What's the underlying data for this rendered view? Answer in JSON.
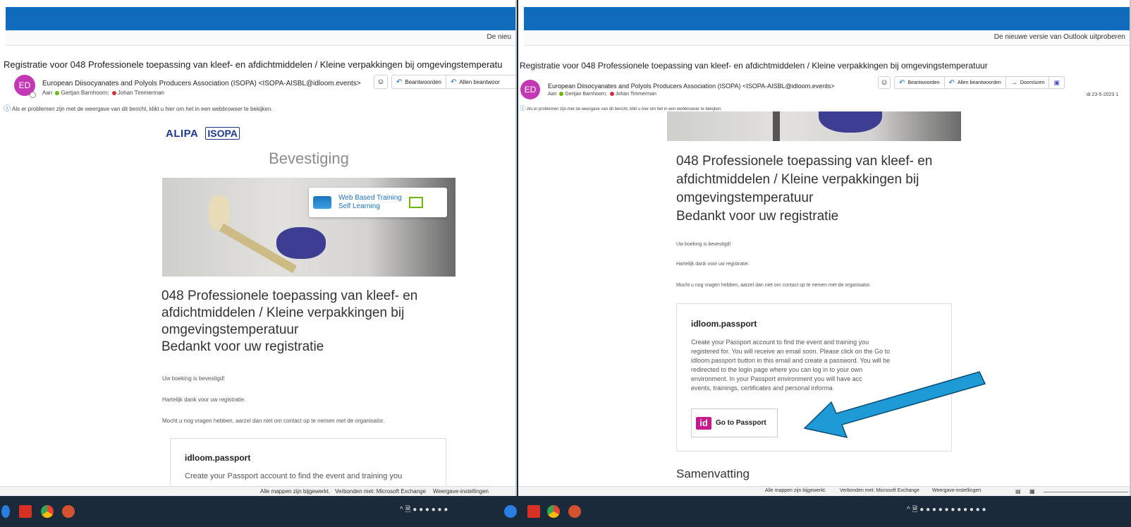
{
  "left": {
    "notice": "De nieu",
    "subject": "Registratie voor 048 Professionele toepassing van kleef- en afdichtmiddelen / Kleine verpakkingen bij omgevingstemperatu",
    "avatar": "ED",
    "sender": "European Diisocyanates and Polyols Producers Association (ISOPA) <ISOPA-AISBL@idloom.events>",
    "recipients_prefix": "Aan",
    "recipient1": "Gertjan Barnhoorn;",
    "recipient2": "Johan Timmerman",
    "actions": [
      "Beantwoorden",
      "Allen beantwoor"
    ],
    "info": "Als er problemen zijn met de weergave van dit bericht, klikt u hier om het in een webbrowser te bekijken.",
    "logo1": "ALIPA",
    "logo2": "ISOPA",
    "heading": "Bevestiging",
    "hero_line1": "Web Based Training",
    "hero_line2": "Self Learning",
    "title_l1": "048 Professionele toepassing van kleef- en",
    "title_l2": "afdichtmiddelen / Kleine verpakkingen bij",
    "title_l3": "omgevingstemperatuur",
    "title_l4": "Bedankt voor uw registratie",
    "p1": "Uw boeking is bevestigd!",
    "p2": "Hartelijk dank voor uw registratie.",
    "p3": "Mocht u nog vragen hebben, aarzel dan niet om contact op te nemen met de organisator.",
    "box_title": "idloom.passport",
    "box_text": "Create your Passport account to find the event and training you",
    "status1": "Alle mappen zijn bijgewerkt.",
    "status2": "Verbonden met: Microsoft Exchange",
    "status3": "Weergave-instellingen"
  },
  "right": {
    "notice": "De nieuwe versie van Outlook uitproberen",
    "subject": "Registratie voor 048 Professionele toepassing van kleef- en afdichtmiddelen / Kleine verpakkingen bij omgevingstemperatuur",
    "avatar": "ED",
    "sender": "European Diisocyanates and Polyols Producers Association (ISOPA) <ISOPA-AISBL@idloom.events>",
    "recipients_prefix": "Aan",
    "recipient1": "Gertjan Barnhoorn;",
    "recipient2": "Johan Timmerman",
    "actions": [
      "Beantwoorden",
      "Allen beantwoorden",
      "Doorsturen"
    ],
    "date": "di 23-5-2023 1",
    "info": "Als er problemen zijn met de weergave van dit bericht, klikt u hier om het in een webbrowser te bekijken.",
    "title_l1": "048 Professionele toepassing van kleef- en",
    "title_l2": "afdichtmiddelen / Kleine verpakkingen bij",
    "title_l3": "omgevingstemperatuur",
    "title_l4": "Bedankt voor uw registratie",
    "p1": "Uw boeking is bevestigd!",
    "p2": "Hartelijk dank voor uw registratie.",
    "p3": "Mocht u nog vragen hebben, aarzel dan niet om contact op te nemen met de organisator.",
    "box_title": "idloom.passport",
    "box_text1": "Create your Passport account to find the event and training you",
    "box_text2": "registered for. You will receive an email soon. Please click on the Go to",
    "box_text3": "idloom.passport button in this email and create a password. You will be",
    "box_text4": "redirected to the login page where you can log in to your own",
    "box_text5": "environment. In your Passport environment you will have acc",
    "box_text6": "events, trainings, certificates and personal informa",
    "passport_icon": "id",
    "passport_button": "Go to Passport",
    "summary": "Samenvatting",
    "status1": "Alle mappen zijn bijgewerkt.",
    "status2": "Verbonden met: Microsoft Exchange",
    "status3": "Weergave-instellingen"
  },
  "colors": {
    "outlook_blue": "#0f6cbd",
    "avatar": "#c239b3",
    "idloom": "#c8198c",
    "arrow": "#1e9bd7"
  }
}
